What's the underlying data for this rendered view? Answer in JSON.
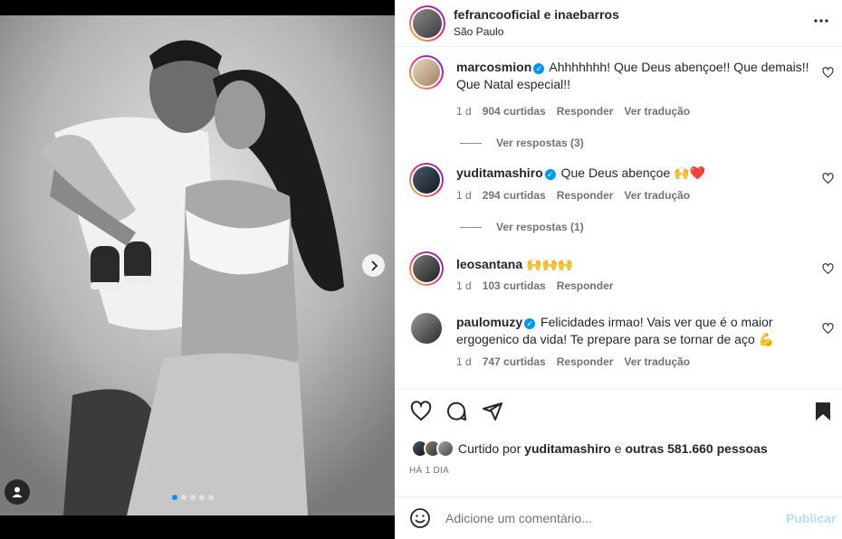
{
  "post": {
    "author": "fefrancooficial",
    "conjunction": "e",
    "coauthor": "inaebarros",
    "location": "São Paulo",
    "carousel": {
      "count": 5,
      "active_index": 0
    }
  },
  "comments": [
    {
      "username": "marcosmion",
      "verified": true,
      "text": "Ahhhhhhh! Que Deus abençoe!! Que demais!! Que Natal especial!!",
      "age": "1 d",
      "likes": "904 curtidas",
      "reply": "Responder",
      "translate": "Ver tradução",
      "view_replies": "Ver respostas (3)"
    },
    {
      "username": "yuditamashiro",
      "verified": true,
      "text": "Que Deus abençoe 🙌❤️",
      "age": "1 d",
      "likes": "294 curtidas",
      "reply": "Responder",
      "translate": "Ver tradução",
      "view_replies": "Ver respostas (1)"
    },
    {
      "username": "leosantana",
      "verified": false,
      "text": "🙌🙌🙌",
      "age": "1 d",
      "likes": "103 curtidas",
      "reply": "Responder"
    },
    {
      "username": "paulomuzy",
      "verified": true,
      "text": "Felicidades irmao! Vais ver que é o maior ergogenico da vida! Te prepare para se tornar de aço 💪",
      "age": "1 d",
      "likes": "747 curtidas",
      "reply": "Responder",
      "translate": "Ver tradução"
    }
  ],
  "likes_summary": {
    "prefix": "Curtido por",
    "user": "yuditamashiro",
    "middle": "e",
    "others": "outras 581.660 pessoas"
  },
  "time_ago": "HÁ 1 DIA",
  "comment_box": {
    "placeholder": "Adicione um comentário...",
    "publish_label": "Publicar"
  },
  "colors": {
    "accent": "#0095f6",
    "publish_disabled": "#b2dffc",
    "like_heart": "#ed4956"
  }
}
